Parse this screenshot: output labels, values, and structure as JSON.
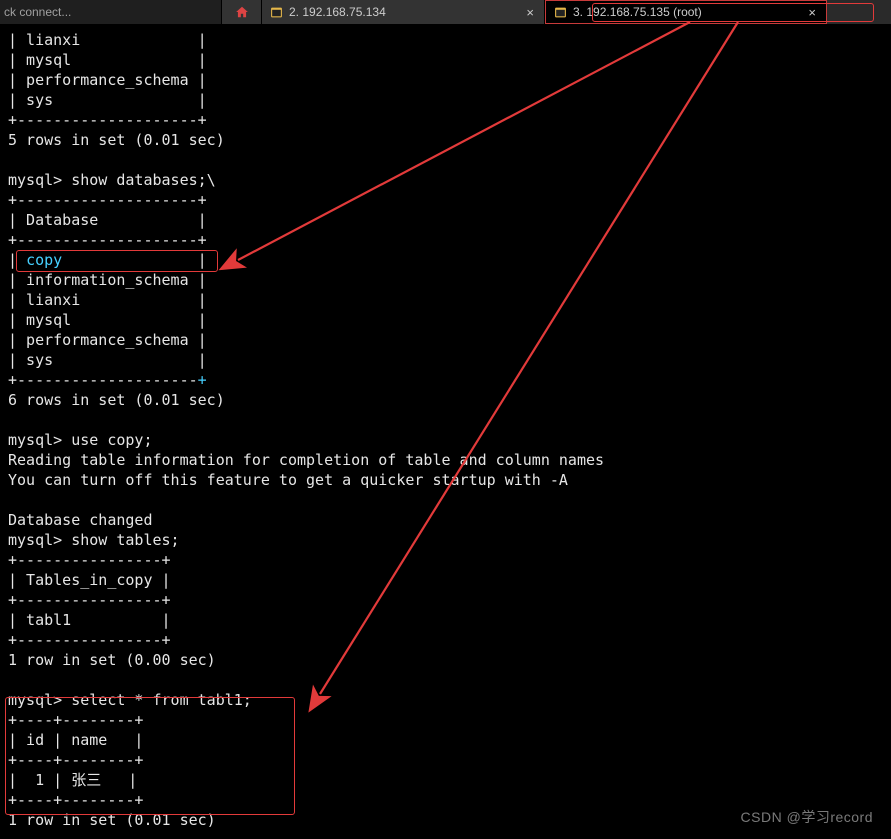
{
  "tabs": {
    "left_hint": "ck connect...",
    "tab2_label": "2. 192.168.75.134",
    "tab3_label": "3. 192.168.75.135 (root)"
  },
  "terminal": {
    "l00": "| lianxi             |",
    "l01": "| mysql              |",
    "l02": "| performance_schema |",
    "l03": "| sys                |",
    "l04": "+--------------------+",
    "l05": "5 rows in set (0.01 sec)",
    "l06": "",
    "l07": "mysql> show databases;\\",
    "l08": "+--------------------+",
    "l09": "| Database           |",
    "l10": "+--------------------+",
    "l11a": "| ",
    "l11b_copy": "copy",
    "l11c": "               |",
    "l12": "| information_schema |",
    "l13": "| lianxi             |",
    "l14": "| mysql              |",
    "l15": "| performance_schema |",
    "l16": "| sys                |",
    "l17a": "+--------------------",
    "l17b_cursor": "+",
    "l18": "6 rows in set (0.01 sec)",
    "l19": "",
    "l20": "mysql> use copy;",
    "l21": "Reading table information for completion of table and column names",
    "l22": "You can turn off this feature to get a quicker startup with -A",
    "l23": "",
    "l24": "Database changed",
    "l25": "mysql> show tables;",
    "l26": "+----------------+",
    "l27": "| Tables_in_copy |",
    "l28": "+----------------+",
    "l29": "| tabl1          |",
    "l30": "+----------------+",
    "l31": "1 row in set (0.00 sec)",
    "l32": "",
    "l33": "mysql> select * from tabl1;",
    "l34": "+----+--------+",
    "l35": "| id | name   |",
    "l36": "+----+--------+",
    "l37": "|  1 | 张三   |",
    "l38": "+----+--------+",
    "l39": "1 row in set (0.01 sec)"
  },
  "watermark": "CSDN @学习record"
}
